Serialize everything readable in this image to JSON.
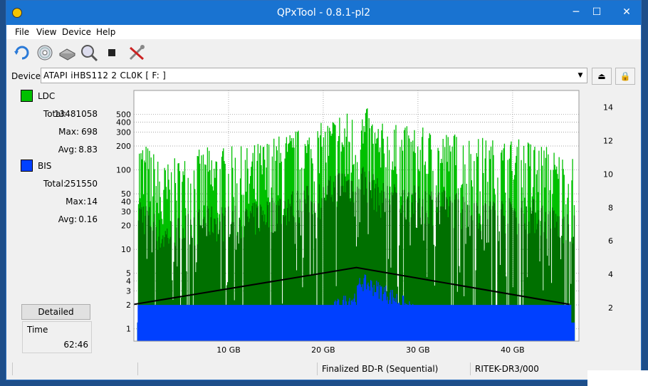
{
  "window": {
    "title": "QPxTool - 0.8.1-pl2",
    "minimize_glyph": "─",
    "maximize_glyph": "☐",
    "close_glyph": "✕"
  },
  "menu": [
    "File",
    "View",
    "Device",
    "Help"
  ],
  "toolbar": {
    "icons": [
      "refresh-icon",
      "disc-info-icon",
      "drive-icon",
      "scan-icon",
      "stop-icon",
      "tools-icon"
    ]
  },
  "device": {
    "label": "Device:",
    "value": "ATAPI   iHBS112  2    CL0K [ F: ]",
    "arrow_glyph": "▼",
    "eject_glyph": "⏏",
    "lock_glyph": "🔒"
  },
  "legend": {
    "ldc": {
      "name": "LDC",
      "color": "#00c000",
      "total_label": "Total:",
      "total": "13481058",
      "max_label": "Max:",
      "max": "698",
      "avg_label": "Avg:",
      "avg": "8.83"
    },
    "bis": {
      "name": "BIS",
      "color": "#0040ff",
      "total_label": "Total:",
      "total": "251550",
      "max_label": "Max:",
      "max": "14",
      "avg_label": "Avg:",
      "avg": "0.16"
    }
  },
  "detailed_label": "Detailed",
  "time": {
    "label": "Time",
    "value": "62:46"
  },
  "status": {
    "cells": [
      "",
      "",
      "Finalized BD-R (Sequential)",
      "RITEK-DR3/000"
    ]
  },
  "chart_data": {
    "type": "area",
    "x_unit": "GB",
    "xlim": [
      0,
      47
    ],
    "x_ticks": [
      10,
      20,
      30,
      40
    ],
    "x_tick_labels": [
      "10 GB",
      "20 GB",
      "30 GB",
      "40 GB"
    ],
    "y_left_scale": "log",
    "ylim_left": [
      0.7,
      1000
    ],
    "y_left_ticks": [
      1,
      2,
      3,
      4,
      5,
      10,
      20,
      30,
      40,
      50,
      100,
      200,
      300,
      400,
      500
    ],
    "y_right_ticks": [
      2,
      4,
      6,
      8,
      10,
      12,
      14
    ],
    "ylim_right": [
      0,
      15
    ],
    "grid": true,
    "series": [
      {
        "name": "LDC",
        "color": "#00c000",
        "envelope_x": [
          0,
          3,
          8,
          12,
          16,
          18,
          20,
          22,
          23.5,
          24,
          26,
          30,
          34,
          38,
          42,
          46
        ],
        "envelope_max": [
          300,
          120,
          200,
          200,
          300,
          350,
          400,
          600,
          500,
          698,
          400,
          350,
          300,
          250,
          250,
          150
        ]
      },
      {
        "name": "BIS",
        "color": "#0040ff",
        "envelope_x": [
          0,
          5,
          10,
          15,
          20,
          23.5,
          24,
          30,
          35,
          40,
          46
        ],
        "envelope_max": [
          2,
          2,
          3,
          4,
          5,
          9,
          14,
          5,
          4,
          3,
          2
        ]
      },
      {
        "name": "Speed",
        "color": "#000000",
        "x": [
          0,
          23.5,
          46
        ],
        "y": [
          2.2,
          4.4,
          2.2
        ]
      }
    ]
  }
}
